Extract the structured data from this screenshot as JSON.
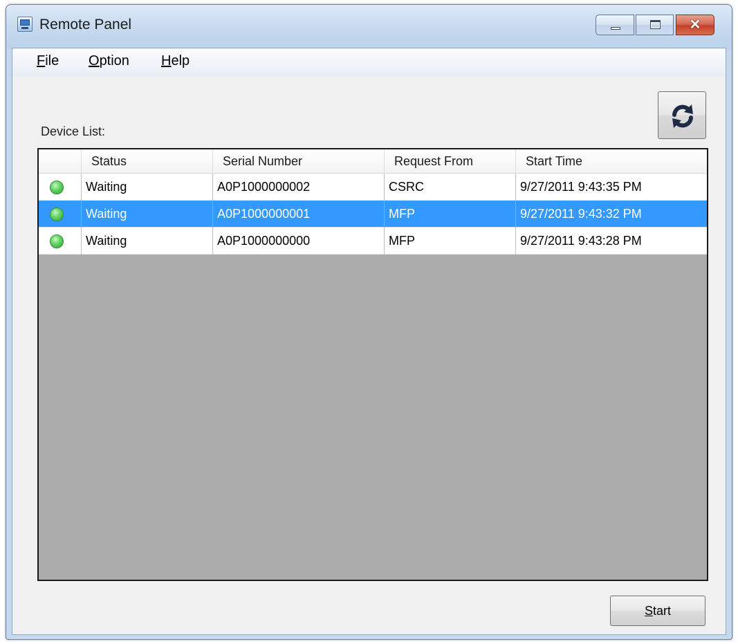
{
  "window": {
    "title": "Remote Panel"
  },
  "menu": {
    "file": {
      "mnemonic": "F",
      "rest": "ile"
    },
    "option": {
      "mnemonic": "O",
      "rest": "ption"
    },
    "help": {
      "mnemonic": "H",
      "rest": "elp"
    }
  },
  "device_list": {
    "label": "Device List:",
    "columns": [
      "",
      "Status",
      "Serial Number",
      "Request From",
      "Start Time"
    ],
    "rows": [
      {
        "status_icon": "green-led-icon",
        "status": "Waiting",
        "serial": "A0P1000000002",
        "request_from": "CSRC",
        "start_time": "9/27/2011 9:43:35 PM",
        "selected": false
      },
      {
        "status_icon": "green-led-icon",
        "status": "Waiting",
        "serial": "A0P1000000001",
        "request_from": "MFP",
        "start_time": "9/27/2011 9:43:32 PM",
        "selected": true
      },
      {
        "status_icon": "green-led-icon",
        "status": "Waiting",
        "serial": "A0P1000000000",
        "request_from": "MFP",
        "start_time": "9/27/2011 9:43:28 PM",
        "selected": false
      }
    ]
  },
  "buttons": {
    "start": {
      "mnemonic": "S",
      "rest": "tart"
    },
    "refresh_icon": "refresh-icon"
  },
  "colors": {
    "selection": "#3399ff",
    "led": "#5fd35f",
    "empty_area": "#ababab"
  }
}
